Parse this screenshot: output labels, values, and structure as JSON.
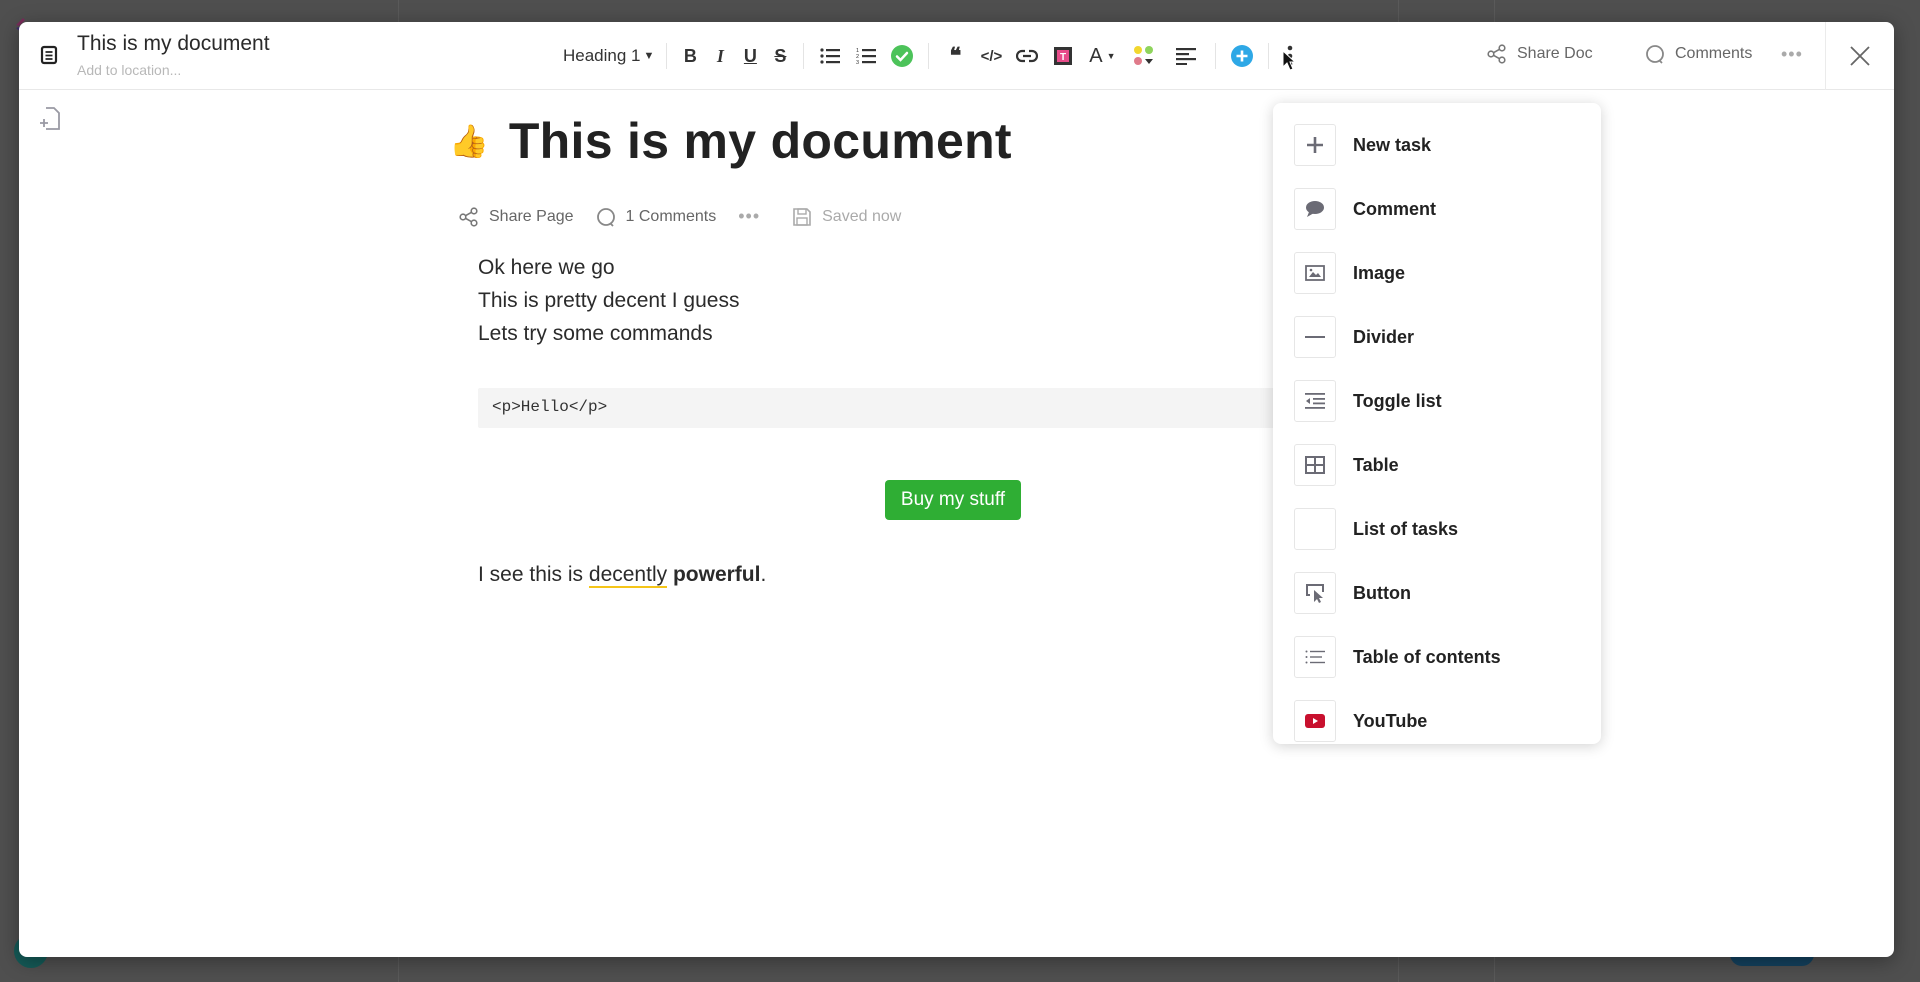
{
  "header": {
    "doc_title": "This is my document",
    "location_placeholder": "Add to location..."
  },
  "toolbar": {
    "heading_style": "Heading 1",
    "items": [
      {
        "name": "bold",
        "glyph": "B"
      },
      {
        "name": "italic",
        "glyph": "I"
      },
      {
        "name": "underline",
        "glyph": "U"
      },
      {
        "name": "strikethrough",
        "glyph": "S"
      }
    ],
    "share_doc_label": "Share Doc",
    "comments_label": "Comments",
    "more_glyph": "•••"
  },
  "page": {
    "emoji": "👍",
    "title": "This is my document",
    "meta": {
      "share_label": "Share Page",
      "comments_label": "1 Comments",
      "dots": "•••",
      "saved_label": "Saved now"
    },
    "paragraphs": [
      "Ok here we go",
      "This is pretty decent I guess",
      "Lets try some commands"
    ],
    "code": "<p>Hello</p>",
    "button_label": "Buy my stuff",
    "final": {
      "prefix": "I see this is ",
      "underlined": "decently",
      "space": " ",
      "bold": "powerful",
      "suffix": "."
    }
  },
  "insert_menu": {
    "items": [
      {
        "label": "New task",
        "icon": "plus-icon"
      },
      {
        "label": "Comment",
        "icon": "comment-icon"
      },
      {
        "label": "Image",
        "icon": "image-icon"
      },
      {
        "label": "Divider",
        "icon": "divider-icon"
      },
      {
        "label": "Toggle list",
        "icon": "toggle-list-icon"
      },
      {
        "label": "Table",
        "icon": "table-icon"
      },
      {
        "label": "List of tasks",
        "icon": "list-of-tasks-icon"
      },
      {
        "label": "Button",
        "icon": "button-icon"
      },
      {
        "label": "Table of contents",
        "icon": "table-of-contents-icon"
      },
      {
        "label": "YouTube",
        "icon": "youtube-icon"
      }
    ]
  },
  "colors": {
    "accent_blue": "#2ea8e6",
    "check_green": "#4cc35a",
    "button_green": "#2fae34",
    "youtube_red": "#c8102e",
    "underline_yellow": "#f5c518"
  }
}
